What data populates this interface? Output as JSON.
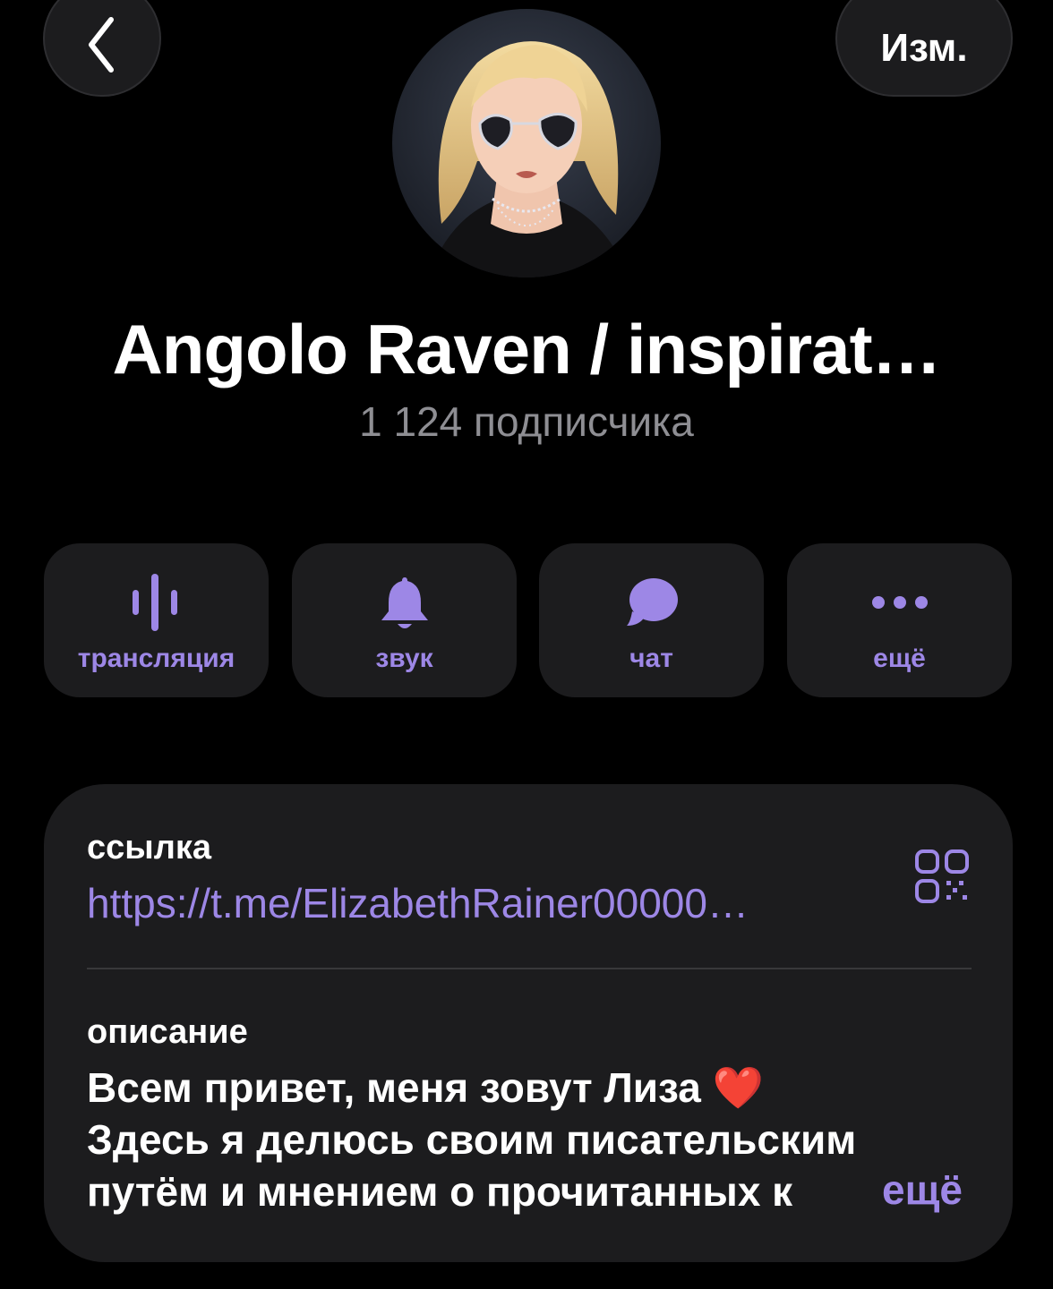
{
  "nav": {
    "edit_label": "Изм."
  },
  "channel": {
    "title": "Angolo Raven / inspirat…",
    "subscribers": "1 124 подписчика"
  },
  "actions": [
    {
      "label": "трансляция",
      "icon": "voice-chat-icon"
    },
    {
      "label": "звук",
      "icon": "bell-icon"
    },
    {
      "label": "чат",
      "icon": "chat-bubble-icon"
    },
    {
      "label": "ещё",
      "icon": "more-dots-icon"
    }
  ],
  "info": {
    "link_label": "ссылка",
    "link_value": "https://t.me/ElizabethRainer00000…",
    "description_label": "описание",
    "description_lines": [
      "Всем привет, меня зовут Лиза ❤️",
      "Здесь я делюсь своим писательским",
      "путём и мнением о прочитанных к"
    ],
    "more_label": "ещё"
  },
  "colors": {
    "background": "#000000",
    "card": "#1c1c1e",
    "accent": "#9d87e6",
    "secondary_text": "#8e8e93",
    "divider": "#38383a"
  }
}
